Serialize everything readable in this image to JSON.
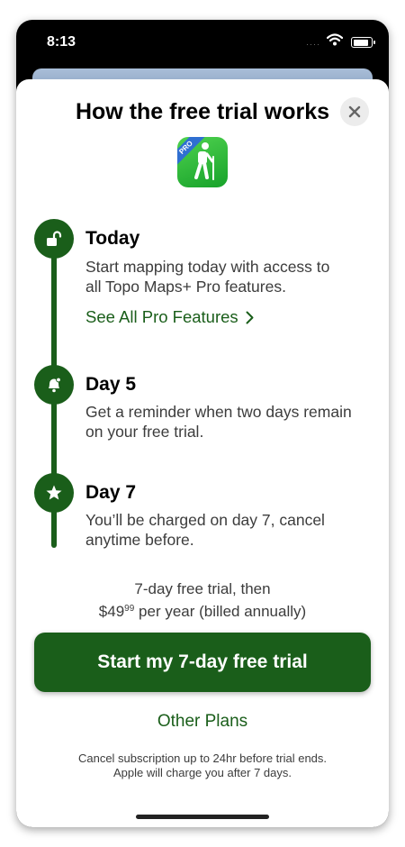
{
  "status_bar": {
    "time": "8:13",
    "signal": "····"
  },
  "header": {
    "title": "How the free trial works"
  },
  "app_icon": {
    "badge": "PRO",
    "icon": "hiker-icon"
  },
  "steps": [
    {
      "title": "Today",
      "line1": "Start mapping today with access to",
      "line2": "all Topo Maps+ Pro features.",
      "icon": "unlock-icon"
    },
    {
      "title": "Day 5",
      "line1": "Get a reminder when two days remain",
      "line2": "on your free trial.",
      "icon": "bell-icon"
    },
    {
      "title": "Day 7",
      "line1": "You’ll be charged on day 7, cancel",
      "line2": "anytime before.",
      "icon": "star-icon"
    }
  ],
  "features_link": {
    "label": "See All Pro Features"
  },
  "pricing": {
    "line1": "7-day free trial, then",
    "price_main": "$49",
    "price_cents": "99",
    "price_suffix": "per year (billed annually)"
  },
  "cta": {
    "label": "Start my 7-day free trial"
  },
  "other_plans": {
    "label": "Other Plans"
  },
  "fine_print": {
    "line1": "Cancel subscription up to 24hr before trial ends.",
    "line2": "Apple will charge you after 7 days."
  },
  "colors": {
    "accent": "#1a5e1a",
    "app_icon": "#2fb83a",
    "badge": "#2f6fd1"
  }
}
